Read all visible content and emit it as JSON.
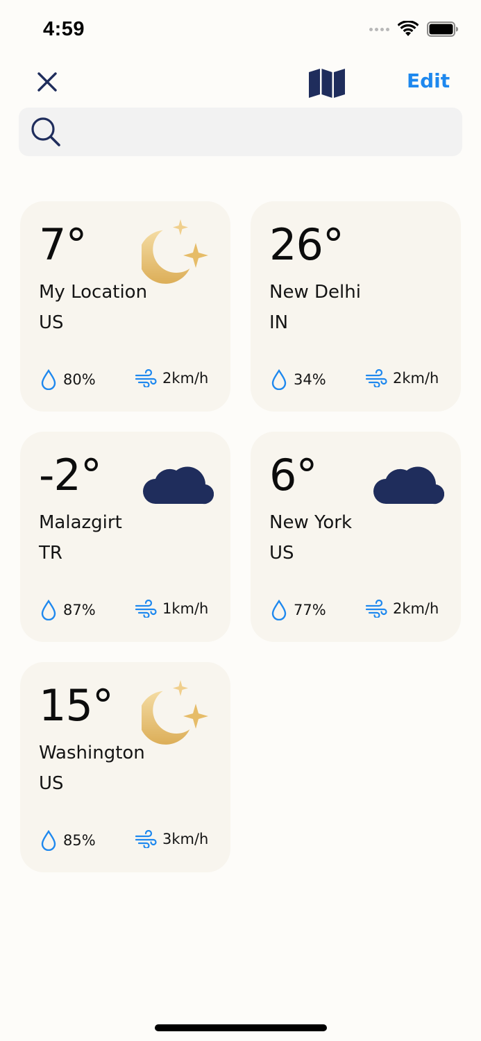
{
  "status_bar": {
    "time": "4:59"
  },
  "nav": {
    "close_icon": "close-icon",
    "map_icon": "map-icon",
    "edit_label": "Edit"
  },
  "search": {
    "placeholder": "",
    "value": ""
  },
  "colors": {
    "accent": "#1e88ee",
    "navy": "#1f2d5c",
    "card_bg": "#f8f5ee",
    "gold": "#e6bc68"
  },
  "cards": [
    {
      "temp": "7°",
      "city": "My Location",
      "country": "US",
      "humidity": "80%",
      "wind": "2km/h",
      "icon": "moon-stars-icon"
    },
    {
      "temp": "26°",
      "city": "New Delhi",
      "country": "IN",
      "humidity": "34%",
      "wind": "2km/h",
      "icon": ""
    },
    {
      "temp": "-2°",
      "city": "Malazgirt",
      "country": "TR",
      "humidity": "87%",
      "wind": "1km/h",
      "icon": "cloud-icon"
    },
    {
      "temp": "6°",
      "city": "New York",
      "country": "US",
      "humidity": "77%",
      "wind": "2km/h",
      "icon": "cloud-icon"
    },
    {
      "temp": "15°",
      "city": "Washington",
      "country": "US",
      "humidity": "85%",
      "wind": "3km/h",
      "icon": "moon-stars-icon"
    }
  ]
}
